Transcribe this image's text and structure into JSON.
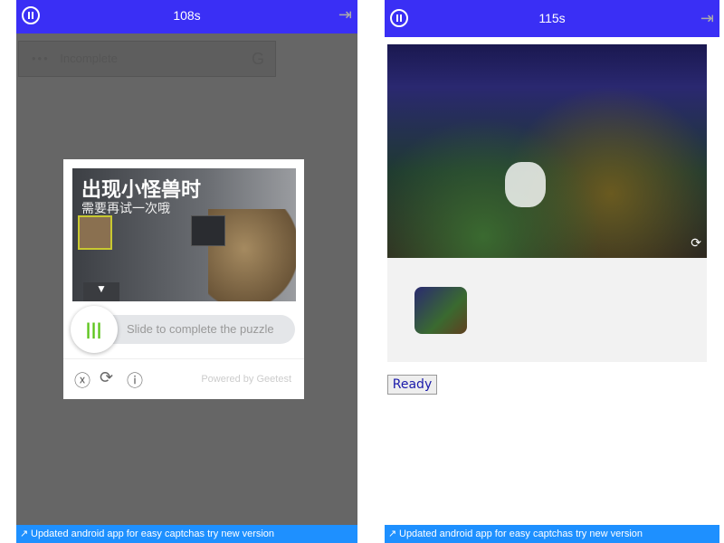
{
  "left": {
    "timer": "108s",
    "status": "Incomplete",
    "captcha": {
      "title": "出现小怪兽时",
      "subtitle": "需要再试一次哦",
      "slider_text": "Slide to complete the puzzle",
      "powered": "Powered by Geetest"
    },
    "banner": "Updated android app for easy captchas try new version"
  },
  "right": {
    "timer": "115s",
    "ready_label": "Ready",
    "banner": "Updated android app for easy captchas try new version"
  },
  "colors": {
    "topbar": "#3a2ff5",
    "banner": "#1e90ff",
    "slider_knob": "#5cc41a"
  }
}
